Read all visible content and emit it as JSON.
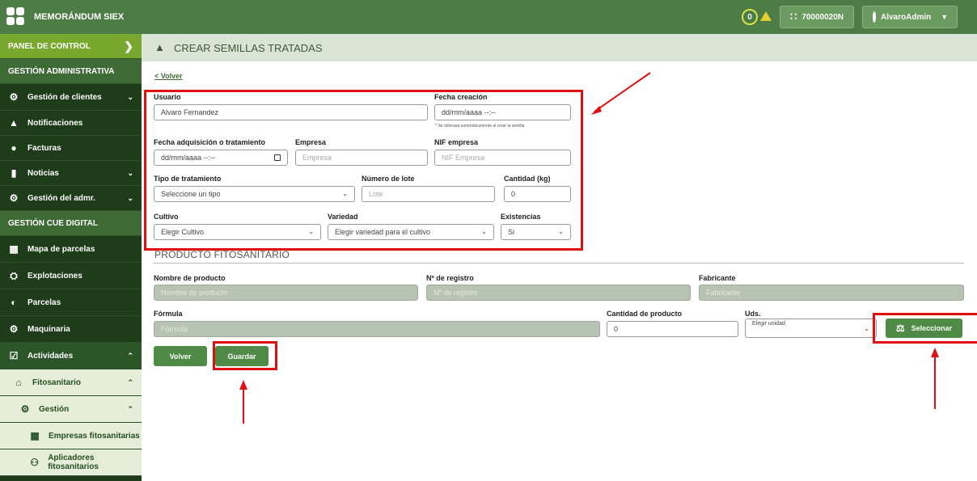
{
  "topbar": {
    "brand": "MEMORÁNDUM SIEX",
    "notifications_count": "0",
    "org_button": "70000020N",
    "user_button": "AlvaroAdmin"
  },
  "sidebar": {
    "items": [
      {
        "label": "PANEL DE CONTROL"
      },
      {
        "label": "GESTIÓN ADMINISTRATIVA"
      },
      {
        "label": "Gestión de clientes"
      },
      {
        "label": "Notificaciones"
      },
      {
        "label": "Facturas"
      },
      {
        "label": "Noticias"
      },
      {
        "label": "Gestión del admr."
      },
      {
        "label": "GESTIÓN CUE DIGITAL"
      },
      {
        "label": "Mapa de parcelas"
      },
      {
        "label": "Explotaciones"
      },
      {
        "label": "Parcelas"
      },
      {
        "label": "Maquinaria"
      },
      {
        "label": "Actividades"
      },
      {
        "label": "Fitosanitario"
      },
      {
        "label": "Gestión"
      },
      {
        "label": "Empresas fitosanitarias"
      },
      {
        "label": "Aplicadores fitosanitarios"
      }
    ]
  },
  "page": {
    "title": "CREAR SEMILLAS TRATADAS",
    "back_link": "< Volver"
  },
  "form": {
    "usuario_label": "Usuario",
    "usuario_value": "Alvaro Fernandez",
    "fecha_creacion_label": "Fecha creación",
    "fecha_creacion_value": "dd/mm/aaaa --:--",
    "fecha_note": "* Se rellenará automáticamente al crear la semilla",
    "fecha_adq_label": "Fecha adquisición o tratamiento",
    "fecha_adq_value": "dd/mm/aaaa --:--",
    "empresa_label": "Empresa",
    "empresa_placeholder": "Empresa",
    "nif_label": "NIF empresa",
    "nif_placeholder": "NIF Empresa",
    "tipo_label": "Tipo de tratamiento",
    "tipo_value": "Seleccione un tipo",
    "lote_label": "Número de lote",
    "lote_placeholder": "Lote",
    "cantidad_label": "Cantidad (kg)",
    "cantidad_value": "0",
    "cultivo_label": "Cultivo",
    "cultivo_value": "Elegir Cultivo",
    "variedad_label": "Variedad",
    "variedad_value": "Elegir variedad para el cultivo",
    "existencias_label": "Existencias",
    "existencias_value": "Si"
  },
  "producto": {
    "section_title": "PRODUCTO FITOSANITARIO",
    "nombre_label": "Nombre de producto",
    "nombre_placeholder": "Nombre de producto",
    "registro_label": "Nº de registro",
    "registro_placeholder": "Nº de registro",
    "fabricante_label": "Fabricante",
    "fabricante_placeholder": "Fabricante",
    "formula_label": "Fórmula",
    "formula_placeholder": "Fórmula",
    "cantidad_label": "Cantidad de producto",
    "cantidad_value": "0",
    "uds_label": "Uds.",
    "uds_value": "Elegir unidad",
    "seleccionar_button": "Seleccionar"
  },
  "actions": {
    "volver_button": "Volver",
    "guardar_button": "Guardar"
  },
  "colors": {
    "topbar": "#4e7c46",
    "sidebar": "#1e3c1a",
    "annotation": "#e01010"
  }
}
